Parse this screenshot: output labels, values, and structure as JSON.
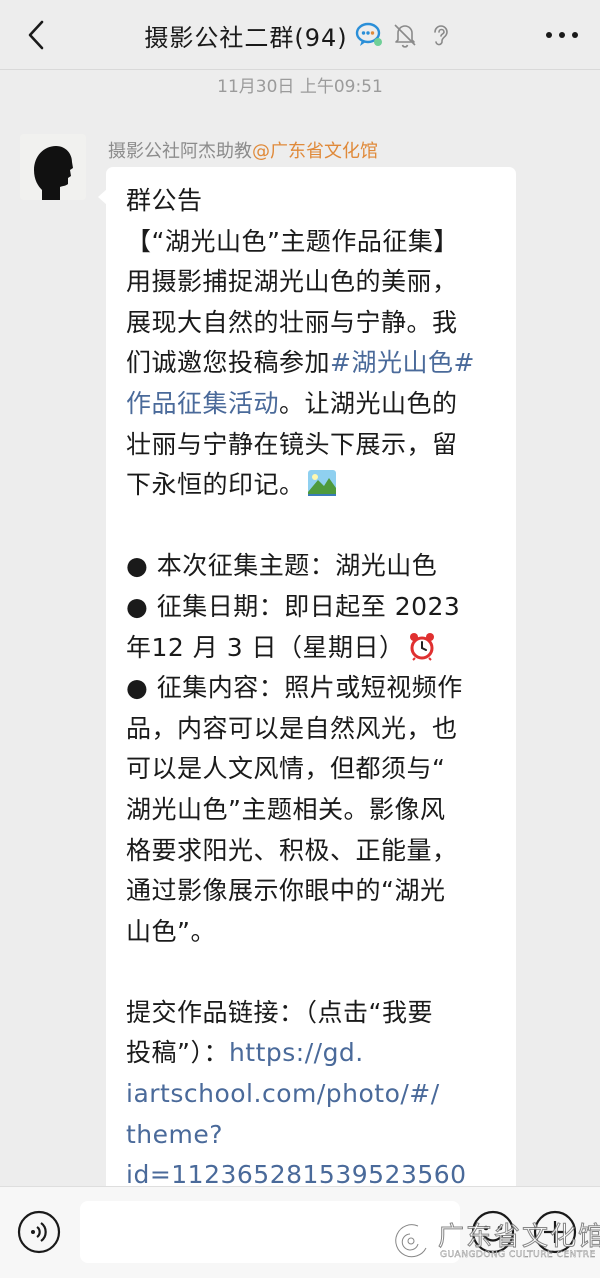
{
  "header": {
    "title": "摄影公社二群(94)"
  },
  "timestamp": "11月30日 上午09:51",
  "message": {
    "sender_name": "摄影公社阿杰助教",
    "sender_org": "@广东省文化馆",
    "lines": [
      "群公告",
      "【“湖光山色”主题作品征集】",
      "用摄影捕捉湖光山色的美丽，",
      "展现大自然的壮丽与宁静。我",
      "们诚邀您投稿参加",
      "作品征集活动",
      "壮丽与宁静在镜头下展示，留",
      "下永恒的印记。",
      "● 本次征集主题：湖光山色",
      "● 征集日期：即日起至 2023",
      "年12 月 3 日（星期日）",
      "● 征集内容：照片或短视频作",
      "品，内容可以是自然风光，也",
      "可以是人文风情，但都须与“",
      "湖光山色”主题相关。影像风",
      "格要求阳光、积极、正能量，",
      "通过影像展示你眼中的“湖光",
      "山色”。",
      "提交作品链接：（点击“我要",
      "投稿”）："
    ],
    "hashtag_part1": "#湖光山色#",
    "after_hashtag": "。让湖光山色的",
    "link_lines": [
      "https://gd.",
      "iartschool.com/photo/#/",
      "theme?",
      "id=112365281539523560"
    ]
  },
  "icons": {
    "back": "chevron-left-icon",
    "chat_bubble": "chat-bubble-icon",
    "mute": "bell-off-icon",
    "ear": "ear-icon",
    "more": "more-dots-icon",
    "landscape": "landscape-emoji-icon",
    "alarm": "alarm-clock-emoji-icon",
    "voice": "voice-icon",
    "emoji": "smiley-icon",
    "plus": "plus-icon"
  },
  "watermark": {
    "text": "广东省文化馆",
    "subtext": "GUANGDONG CULTURE CENTRE"
  },
  "colors": {
    "background": "#ededed",
    "link": "#4a6a9a",
    "org": "#e08a3a",
    "bubble": "#ffffff"
  }
}
